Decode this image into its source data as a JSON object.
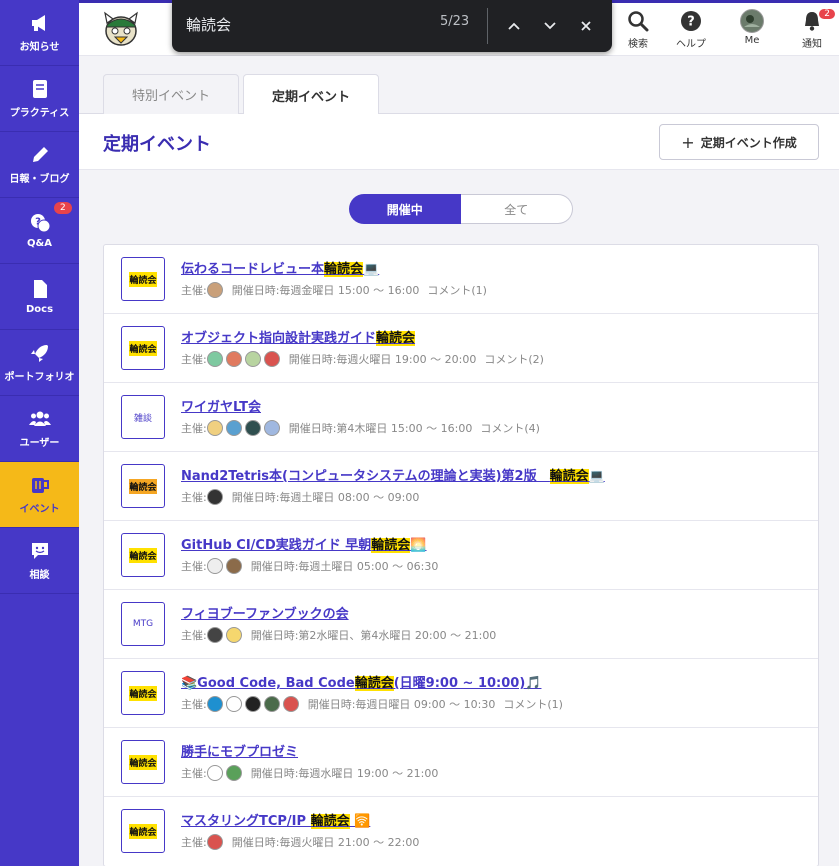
{
  "sidebar": {
    "items": [
      {
        "label": "お知らせ",
        "icon": "megaphone-icon"
      },
      {
        "label": "プラクティス",
        "icon": "book-icon"
      },
      {
        "label": "日報・ブログ",
        "icon": "pencil-icon"
      },
      {
        "label": "Q&A",
        "icon": "question-bubble-icon",
        "badge": "2"
      },
      {
        "label": "Docs",
        "icon": "document-icon"
      },
      {
        "label": "ポートフォリオ",
        "icon": "rocket-icon"
      },
      {
        "label": "ユーザー",
        "icon": "users-icon"
      },
      {
        "label": "イベント",
        "icon": "mug-icon"
      },
      {
        "label": "相談",
        "icon": "chat-smile-icon"
      }
    ]
  },
  "header": {
    "search_label": "検索",
    "help_label": "ヘルプ",
    "me_label": "Me",
    "notify_label": "通知",
    "notify_badge": "2"
  },
  "findbar": {
    "query": "輪読会",
    "count": "5/23"
  },
  "tabs": [
    {
      "label": "特別イベント"
    },
    {
      "label": "定期イベント"
    }
  ],
  "page": {
    "title": "定期イベント",
    "create_button": "定期イベント作成",
    "toggle_on": "開催中",
    "toggle_off": "全て"
  },
  "events": [
    {
      "thumb": "輪読会",
      "title_pre": "伝わるコードレビュー本",
      "title_hl": "輪読会",
      "title_post": "💻",
      "organizer_label": "主催:",
      "schedule": "開催日時:毎週金曜日 15:00 〜 16:00",
      "comments": "コメント(1)",
      "avatars": [
        "#c9a07a"
      ]
    },
    {
      "thumb": "輪読会",
      "title_pre": "オブジェクト指向設計実践ガイド",
      "title_hl": "輪読会",
      "title_post": "",
      "organizer_label": "主催:",
      "schedule": "開催日時:毎週火曜日 19:00 〜 20:00",
      "comments": "コメント(2)",
      "avatars": [
        "#7ec9a0",
        "#e07a5f",
        "#b8d4a0",
        "#d9534f"
      ]
    },
    {
      "thumb": "雑談",
      "title_pre": "ワイガヤLT会",
      "title_hl": "",
      "title_post": "",
      "organizer_label": "主催:",
      "schedule": "開催日時:第4木曜日 15:00 〜 16:00",
      "comments": "コメント(4)",
      "avatars": [
        "#f0d080",
        "#5aa0d0",
        "#2f4f4f",
        "#a0b8e0"
      ]
    },
    {
      "thumb": "輪読会",
      "title_pre": "Nand2Tetris本(コンピュータシステムの理論と実装)第2版　",
      "title_hl": "輪読会",
      "title_post": "💻",
      "organizer_label": "主催:",
      "schedule": "開催日時:毎週土曜日 08:00 〜 09:00",
      "comments": "",
      "avatars": [
        "#333333"
      ]
    },
    {
      "thumb": "輪読会",
      "title_pre": "GitHub CI/CD実践ガイド 早朝",
      "title_hl": "輪読会",
      "title_post": "🌅",
      "organizer_label": "主催:",
      "schedule": "開催日時:毎週土曜日 05:00 〜 06:30",
      "comments": "",
      "avatars": [
        "#eeeeee",
        "#8b6b4a"
      ]
    },
    {
      "thumb": "MTG",
      "title_pre": "フィヨブーファンブックの会",
      "title_hl": "",
      "title_post": "",
      "organizer_label": "主催:",
      "schedule": "開催日時:第2水曜日、第4水曜日 20:00 〜 21:00",
      "comments": "",
      "avatars": [
        "#444444",
        "#f5d76e"
      ]
    },
    {
      "thumb": "輪読会",
      "title_pre": "📚Good Code, Bad Code",
      "title_hl": "輪読会",
      "title_post": "(日曜9:00 ~ 10:00)🎵",
      "organizer_label": "主催:",
      "schedule": "開催日時:毎週日曜日 09:00 〜 10:30",
      "comments": "コメント(1)",
      "avatars": [
        "#1e90d0",
        "#ffffff",
        "#222222",
        "#4a6b4a",
        "#d9534f"
      ]
    },
    {
      "thumb": "輪読会",
      "title_pre": "勝手にモブプロゼミ",
      "title_hl": "",
      "title_post": "",
      "organizer_label": "主催:",
      "schedule": "開催日時:毎週水曜日 19:00 〜 21:00",
      "comments": "",
      "avatars": [
        "#ffffff",
        "#5aa05a"
      ]
    },
    {
      "thumb": "輪読会",
      "title_pre": "マスタリングTCP/IP ",
      "title_hl": "輪読会",
      "title_post": " 🛜",
      "organizer_label": "主催:",
      "schedule": "開催日時:毎週火曜日 21:00 〜 22:00",
      "comments": "",
      "avatars": [
        "#d9534f"
      ]
    }
  ]
}
